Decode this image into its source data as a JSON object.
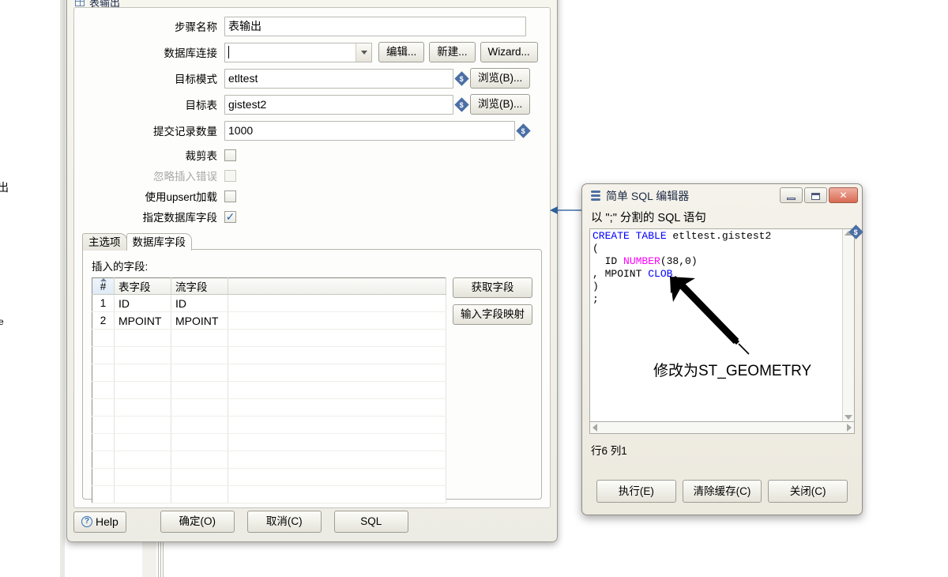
{
  "background": {
    "fragment_left_1": "出",
    "fragment_left_2": "e"
  },
  "main_dialog": {
    "title": "表输出",
    "icon": "grid-icon",
    "window_buttons": {
      "minimize": "–",
      "maximize": "□",
      "close": "✕"
    },
    "fields": [
      {
        "label": "步骤名称",
        "value": "表输出",
        "type": "text"
      },
      {
        "label": "数据库连接",
        "value": "",
        "type": "combo"
      },
      {
        "label": "目标模式",
        "value": "etltest",
        "type": "text-var"
      },
      {
        "label": "目标表",
        "value": "gistest2",
        "type": "text-var"
      },
      {
        "label": "提交记录数量",
        "value": "1000",
        "type": "text-var"
      }
    ],
    "field_buttons": {
      "edit": "编辑...",
      "new": "新建...",
      "wizard": "Wizard...",
      "browse_schema": "浏览(B)...",
      "browse_table": "浏览(B)..."
    },
    "checkboxes": [
      {
        "label": "裁剪表",
        "checked": false,
        "disabled": false
      },
      {
        "label": "忽略插入错误",
        "checked": false,
        "disabled": true
      },
      {
        "label": "使用upsert加载",
        "checked": false,
        "disabled": false
      },
      {
        "label": "指定数据库字段",
        "checked": true,
        "disabled": false
      }
    ],
    "tabs": [
      {
        "label": "主选项",
        "active": false
      },
      {
        "label": "数据库字段",
        "active": true
      }
    ],
    "panel": {
      "label": "插入的字段:",
      "columns": [
        "#",
        "表字段",
        "流字段",
        ""
      ],
      "rows": [
        {
          "index": "1",
          "table_field": "ID",
          "stream_field": "ID"
        },
        {
          "index": "2",
          "table_field": "MPOINT",
          "stream_field": "MPOINT"
        }
      ],
      "empty_row_count": 10,
      "side_buttons": {
        "get_fields": "获取字段",
        "field_mapping": "输入字段映射"
      }
    },
    "footer": {
      "help": "Help",
      "ok": "确定(O)",
      "cancel": "取消(C)",
      "sql": "SQL"
    }
  },
  "sql_dialog": {
    "title": "简单 SQL 编辑器",
    "icon": "database-icon",
    "window_buttons": {
      "minimize": "–",
      "maximize": "□",
      "close": "✕"
    },
    "caption": "以 \";\" 分割的 SQL 语句",
    "code_lines": [
      {
        "tokens": [
          {
            "t": "CREATE TABLE",
            "c": "kw"
          },
          {
            "t": " etltest.gistest2",
            "c": ""
          }
        ]
      },
      {
        "tokens": [
          {
            "t": "(",
            "c": ""
          }
        ]
      },
      {
        "tokens": [
          {
            "t": "  ID ",
            "c": ""
          },
          {
            "t": "NUMBER",
            "c": "ty"
          },
          {
            "t": "(38,0)",
            "c": ""
          }
        ]
      },
      {
        "tokens": [
          {
            "t": ", MPOINT ",
            "c": ""
          },
          {
            "t": "CLOB",
            "c": "kw"
          }
        ]
      },
      {
        "tokens": [
          {
            "t": ")",
            "c": ""
          }
        ]
      },
      {
        "tokens": [
          {
            "t": ";",
            "c": ""
          }
        ]
      }
    ],
    "status": "行6 列1",
    "footer": {
      "execute": "执行(E)",
      "clear_cache": "清除缓存(C)",
      "close": "关闭(C)"
    }
  },
  "annotation": {
    "text": "修改为ST_GEOMETRY"
  },
  "colors": {
    "keyword": "#0000ff",
    "datatype": "#ff00ff",
    "variable_marker": "#4a6fa5",
    "close_button": "#d86a53",
    "dialog_face": "#f0efe8"
  }
}
